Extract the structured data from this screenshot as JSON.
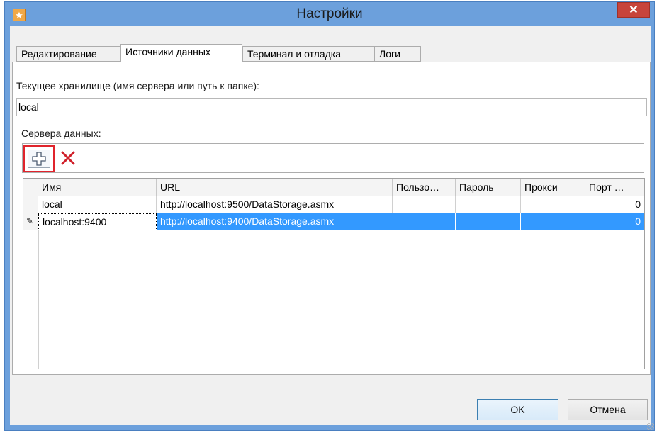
{
  "window": {
    "title": "Настройки",
    "close_glyph": "✕",
    "app_icon": "star-icon"
  },
  "tabs": [
    {
      "label": "Редактирование",
      "active": false
    },
    {
      "label": "Источники данных",
      "active": true
    },
    {
      "label": "Терминал и отладка",
      "active": false
    },
    {
      "label": "Логи",
      "active": false
    }
  ],
  "storage": {
    "label": "Текущее хранилище (имя сервера или путь к папке):",
    "value": "local"
  },
  "servers": {
    "label": "Сервера данных:",
    "toolbar": {
      "add_icon": "plus-icon",
      "delete_icon": "delete-x-icon"
    },
    "columns": [
      "Имя",
      "URL",
      "Пользо…",
      "Пароль",
      "Прокси",
      "Порт …"
    ],
    "rows": [
      {
        "name": "local",
        "url": "http://localhost:9500/DataStorage.asmx",
        "user": "",
        "password": "",
        "proxy": "",
        "port": "0"
      },
      {
        "name": "localhost:9400",
        "url": "http://localhost:9400/DataStorage.asmx",
        "user": "",
        "password": "",
        "proxy": "",
        "port": "0"
      }
    ],
    "edit_marker": "✎"
  },
  "buttons": {
    "ok": "OK",
    "cancel": "Отмена"
  },
  "colors": {
    "title_bar": "#6ca0dc",
    "selection": "#3399ff",
    "highlight_border": "#e0242c",
    "delete": "#d0202a"
  }
}
